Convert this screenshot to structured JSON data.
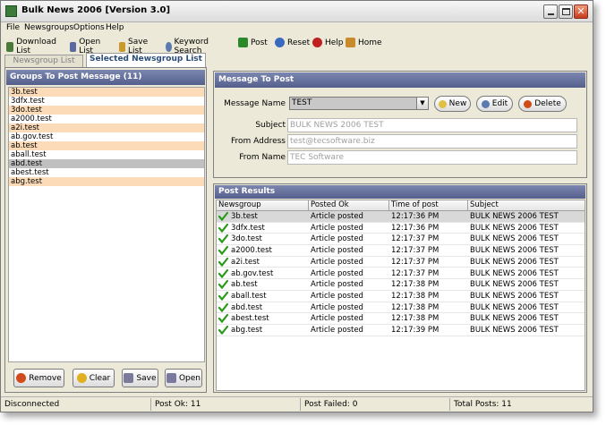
{
  "window": {
    "title": "Bulk News 2006  [Version 3.0]"
  },
  "menu": [
    "File",
    "Newsgroups",
    "Options",
    "Help"
  ],
  "toolbar": [
    {
      "label": "Download List",
      "icon": "download-icon",
      "color": "#4a7a3a"
    },
    {
      "label": "Open List",
      "icon": "open-folder-icon",
      "color": "#5a6aa0"
    },
    {
      "label": "Save List",
      "icon": "save-icon",
      "color": "#c89a2a"
    },
    {
      "label": "Keyword Search",
      "icon": "search-icon",
      "color": "#5a7ab0"
    },
    {
      "label": "Post",
      "icon": "post-icon",
      "color": "#2a8a2a"
    },
    {
      "label": "Reset",
      "icon": "reset-icon",
      "color": "#3a6ac0"
    },
    {
      "label": "Help",
      "icon": "help-icon",
      "color": "#c02020"
    },
    {
      "label": "Home",
      "icon": "home-icon",
      "color": "#c88a2a"
    }
  ],
  "tabs": [
    {
      "label": "Newsgroup List",
      "active": false
    },
    {
      "label": "Selected Newsgroup List",
      "active": true
    }
  ],
  "groups_panel": {
    "header": "Groups To Post Message  (11)",
    "items": [
      "3b.test",
      "3dfx.test",
      "3do.test",
      "a2000.test",
      "a2i.test",
      "ab.gov.test",
      "ab.test",
      "aball.test",
      "abd.test",
      "abest.test",
      "abg.test"
    ],
    "selected_index": 8,
    "buttons": [
      {
        "label": "Remove",
        "icon": "remove-icon",
        "color": "#d04a1a"
      },
      {
        "label": "Clear",
        "icon": "clear-icon",
        "color": "#e0b020"
      },
      {
        "label": "Save",
        "icon": "save-icon",
        "color": "#7a7a9a"
      },
      {
        "label": "Open",
        "icon": "open-folder-icon",
        "color": "#7a7aa0"
      }
    ]
  },
  "message_panel": {
    "header": "Message To Post",
    "message_name_label": "Message Name",
    "message_name_value": "TEST",
    "new_label": "New",
    "edit_label": "Edit",
    "delete_label": "Delete",
    "subject_label": "Subject",
    "subject_value": "BULK NEWS 2006 TEST",
    "from_address_label": "From Address",
    "from_address_value": "test@tecsoftware.biz",
    "from_name_label": "From Name",
    "from_name_value": "TEC Software"
  },
  "results_panel": {
    "header": "Post Results",
    "columns": [
      "Newsgroup",
      "Posted Ok",
      "Time of post",
      "Subject"
    ],
    "rows": [
      [
        "3b.test",
        "Article posted",
        "12:17:36 PM",
        "BULK NEWS 2006 TEST"
      ],
      [
        "3dfx.test",
        "Article posted",
        "12:17:36 PM",
        "BULK NEWS 2006 TEST"
      ],
      [
        "3do.test",
        "Article posted",
        "12:17:37 PM",
        "BULK NEWS 2006 TEST"
      ],
      [
        "a2000.test",
        "Article posted",
        "12:17:37 PM",
        "BULK NEWS 2006 TEST"
      ],
      [
        "a2i.test",
        "Article posted",
        "12:17:37 PM",
        "BULK NEWS 2006 TEST"
      ],
      [
        "ab.gov.test",
        "Article posted",
        "12:17:37 PM",
        "BULK NEWS 2006 TEST"
      ],
      [
        "ab.test",
        "Article posted",
        "12:17:38 PM",
        "BULK NEWS 2006 TEST"
      ],
      [
        "aball.test",
        "Article posted",
        "12:17:38 PM",
        "BULK NEWS 2006 TEST"
      ],
      [
        "abd.test",
        "Article posted",
        "12:17:38 PM",
        "BULK NEWS 2006 TEST"
      ],
      [
        "abest.test",
        "Article posted",
        "12:17:38 PM",
        "BULK NEWS 2006 TEST"
      ],
      [
        "abg.test",
        "Article posted",
        "12:17:39 PM",
        "BULK NEWS 2006 TEST"
      ]
    ]
  },
  "status": {
    "connection": "Disconnected",
    "post_ok": "Post Ok: 11",
    "post_failed": "Post Failed: 0",
    "total": "Total Posts: 11"
  },
  "colors": {
    "panel_header": "#5d6794",
    "list_alt": "#fcdcb8",
    "check": "#2a9a1a"
  }
}
